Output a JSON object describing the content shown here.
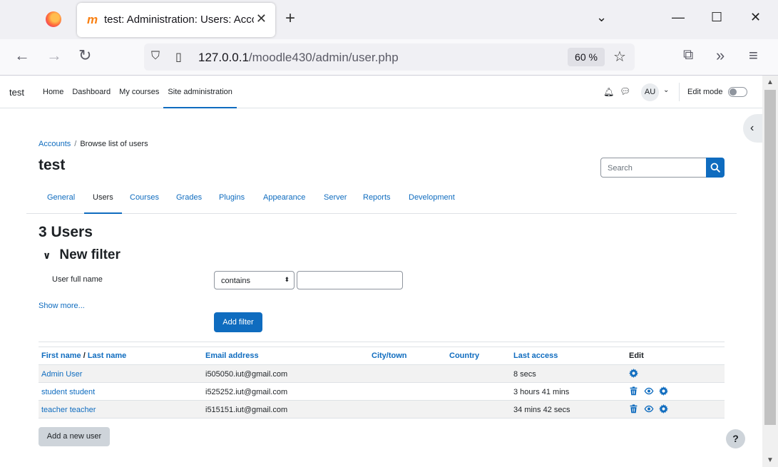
{
  "browser": {
    "tab_title": "test: Administration: Users: Acco",
    "url_host": "127.0.0.1",
    "url_path": "/moodle430/admin/user.php",
    "zoom": "60 %"
  },
  "topnav": {
    "brand": "test",
    "items": [
      "Home",
      "Dashboard",
      "My courses",
      "Site administration"
    ],
    "active": "Site administration",
    "avatar_initials": "AU",
    "edit_mode_label": "Edit mode"
  },
  "breadcrumb": {
    "parent": "Accounts",
    "current": "Browse list of users"
  },
  "page_title": "test",
  "search": {
    "placeholder": "Search"
  },
  "secondary_nav": {
    "items": [
      "General",
      "Users",
      "Courses",
      "Grades",
      "Plugins",
      "Appearance",
      "Server",
      "Reports",
      "Development"
    ],
    "active": "Users"
  },
  "users_heading": "3 Users",
  "filter": {
    "heading": "New filter",
    "field_label": "User full name",
    "operator": "contains",
    "show_more": "Show more...",
    "add_button": "Add filter"
  },
  "table": {
    "headers": {
      "first_name": "First name",
      "slash": " / ",
      "last_name": "Last name",
      "email": "Email address",
      "city": "City/town",
      "country": "Country",
      "last_access": "Last access",
      "edit": "Edit"
    },
    "rows": [
      {
        "name": "Admin User",
        "email": "i505050.iut@gmail.com",
        "city": "",
        "country": "",
        "last_access": "8 secs",
        "actions": [
          "gear-icon"
        ]
      },
      {
        "name": "student student",
        "email": "i525252.iut@gmail.com",
        "city": "",
        "country": "",
        "last_access": "3 hours 41 mins",
        "actions": [
          "trash-icon",
          "eye-icon",
          "gear-icon"
        ]
      },
      {
        "name": "teacher teacher",
        "email": "i515151.iut@gmail.com",
        "city": "",
        "country": "",
        "last_access": "34 mins 42 secs",
        "actions": [
          "trash-icon",
          "eye-icon",
          "gear-icon"
        ]
      }
    ]
  },
  "add_user_button": "Add a new user",
  "help_button": "?",
  "colors": {
    "primary": "#0f6cbf",
    "secondary_btn": "#ced4da",
    "text": "#1d2125"
  }
}
